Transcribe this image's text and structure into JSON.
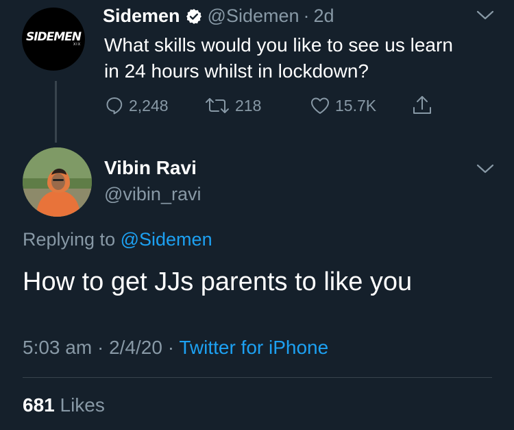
{
  "parent_tweet": {
    "logo_text": "SIDEMEN",
    "logo_sub": "XIX",
    "display_name": "Sidemen",
    "handle": "@Sidemen",
    "separator": "·",
    "age": "2d",
    "text_line1": "What skills would you like to see us learn",
    "text_line2": "in 24 hours whilst in lockdown?",
    "replies": "2,248",
    "retweets": "218",
    "likes": "15.7K",
    "icons": [
      "verified-badge-icon",
      "chevron-down-icon",
      "reply-icon",
      "retweet-icon",
      "like-icon",
      "share-icon"
    ]
  },
  "reply_tweet": {
    "display_name": "Vibin Ravi",
    "handle": "@vibin_ravi",
    "replying_prefix": "Replying to",
    "replying_to": "@Sidemen",
    "text": "How to get JJs parents to like you",
    "time": "5:03 am",
    "dot1": "·",
    "date": "2/4/20",
    "dot2": "·",
    "source": "Twitter for iPhone",
    "likes_count": "681",
    "likes_label": "Likes"
  },
  "colors": {
    "background": "#15202b",
    "secondary_text": "#8899a6",
    "link": "#1da1f2",
    "divider": "#38444d"
  }
}
